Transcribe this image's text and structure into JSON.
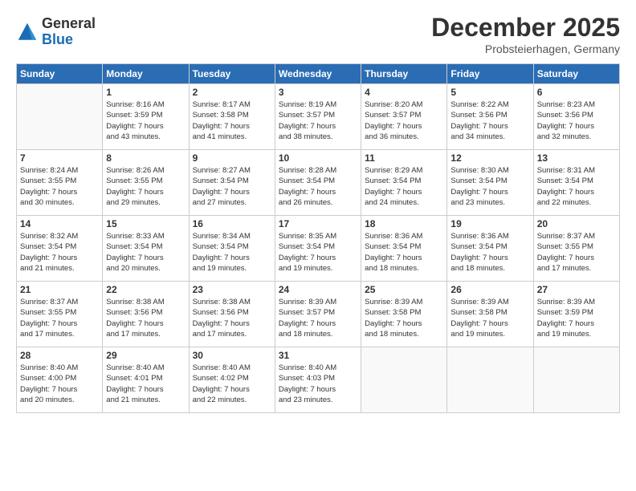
{
  "header": {
    "logo_general": "General",
    "logo_blue": "Blue",
    "month_title": "December 2025",
    "location": "Probsteierhagen, Germany"
  },
  "weekdays": [
    "Sunday",
    "Monday",
    "Tuesday",
    "Wednesday",
    "Thursday",
    "Friday",
    "Saturday"
  ],
  "weeks": [
    [
      {
        "day": "",
        "text": ""
      },
      {
        "day": "1",
        "text": "Sunrise: 8:16 AM\nSunset: 3:59 PM\nDaylight: 7 hours\nand 43 minutes."
      },
      {
        "day": "2",
        "text": "Sunrise: 8:17 AM\nSunset: 3:58 PM\nDaylight: 7 hours\nand 41 minutes."
      },
      {
        "day": "3",
        "text": "Sunrise: 8:19 AM\nSunset: 3:57 PM\nDaylight: 7 hours\nand 38 minutes."
      },
      {
        "day": "4",
        "text": "Sunrise: 8:20 AM\nSunset: 3:57 PM\nDaylight: 7 hours\nand 36 minutes."
      },
      {
        "day": "5",
        "text": "Sunrise: 8:22 AM\nSunset: 3:56 PM\nDaylight: 7 hours\nand 34 minutes."
      },
      {
        "day": "6",
        "text": "Sunrise: 8:23 AM\nSunset: 3:56 PM\nDaylight: 7 hours\nand 32 minutes."
      }
    ],
    [
      {
        "day": "7",
        "text": "Sunrise: 8:24 AM\nSunset: 3:55 PM\nDaylight: 7 hours\nand 30 minutes."
      },
      {
        "day": "8",
        "text": "Sunrise: 8:26 AM\nSunset: 3:55 PM\nDaylight: 7 hours\nand 29 minutes."
      },
      {
        "day": "9",
        "text": "Sunrise: 8:27 AM\nSunset: 3:54 PM\nDaylight: 7 hours\nand 27 minutes."
      },
      {
        "day": "10",
        "text": "Sunrise: 8:28 AM\nSunset: 3:54 PM\nDaylight: 7 hours\nand 26 minutes."
      },
      {
        "day": "11",
        "text": "Sunrise: 8:29 AM\nSunset: 3:54 PM\nDaylight: 7 hours\nand 24 minutes."
      },
      {
        "day": "12",
        "text": "Sunrise: 8:30 AM\nSunset: 3:54 PM\nDaylight: 7 hours\nand 23 minutes."
      },
      {
        "day": "13",
        "text": "Sunrise: 8:31 AM\nSunset: 3:54 PM\nDaylight: 7 hours\nand 22 minutes."
      }
    ],
    [
      {
        "day": "14",
        "text": "Sunrise: 8:32 AM\nSunset: 3:54 PM\nDaylight: 7 hours\nand 21 minutes."
      },
      {
        "day": "15",
        "text": "Sunrise: 8:33 AM\nSunset: 3:54 PM\nDaylight: 7 hours\nand 20 minutes."
      },
      {
        "day": "16",
        "text": "Sunrise: 8:34 AM\nSunset: 3:54 PM\nDaylight: 7 hours\nand 19 minutes."
      },
      {
        "day": "17",
        "text": "Sunrise: 8:35 AM\nSunset: 3:54 PM\nDaylight: 7 hours\nand 19 minutes."
      },
      {
        "day": "18",
        "text": "Sunrise: 8:36 AM\nSunset: 3:54 PM\nDaylight: 7 hours\nand 18 minutes."
      },
      {
        "day": "19",
        "text": "Sunrise: 8:36 AM\nSunset: 3:54 PM\nDaylight: 7 hours\nand 18 minutes."
      },
      {
        "day": "20",
        "text": "Sunrise: 8:37 AM\nSunset: 3:55 PM\nDaylight: 7 hours\nand 17 minutes."
      }
    ],
    [
      {
        "day": "21",
        "text": "Sunrise: 8:37 AM\nSunset: 3:55 PM\nDaylight: 7 hours\nand 17 minutes."
      },
      {
        "day": "22",
        "text": "Sunrise: 8:38 AM\nSunset: 3:56 PM\nDaylight: 7 hours\nand 17 minutes."
      },
      {
        "day": "23",
        "text": "Sunrise: 8:38 AM\nSunset: 3:56 PM\nDaylight: 7 hours\nand 17 minutes."
      },
      {
        "day": "24",
        "text": "Sunrise: 8:39 AM\nSunset: 3:57 PM\nDaylight: 7 hours\nand 18 minutes."
      },
      {
        "day": "25",
        "text": "Sunrise: 8:39 AM\nSunset: 3:58 PM\nDaylight: 7 hours\nand 18 minutes."
      },
      {
        "day": "26",
        "text": "Sunrise: 8:39 AM\nSunset: 3:58 PM\nDaylight: 7 hours\nand 19 minutes."
      },
      {
        "day": "27",
        "text": "Sunrise: 8:39 AM\nSunset: 3:59 PM\nDaylight: 7 hours\nand 19 minutes."
      }
    ],
    [
      {
        "day": "28",
        "text": "Sunrise: 8:40 AM\nSunset: 4:00 PM\nDaylight: 7 hours\nand 20 minutes."
      },
      {
        "day": "29",
        "text": "Sunrise: 8:40 AM\nSunset: 4:01 PM\nDaylight: 7 hours\nand 21 minutes."
      },
      {
        "day": "30",
        "text": "Sunrise: 8:40 AM\nSunset: 4:02 PM\nDaylight: 7 hours\nand 22 minutes."
      },
      {
        "day": "31",
        "text": "Sunrise: 8:40 AM\nSunset: 4:03 PM\nDaylight: 7 hours\nand 23 minutes."
      },
      {
        "day": "",
        "text": ""
      },
      {
        "day": "",
        "text": ""
      },
      {
        "day": "",
        "text": ""
      }
    ]
  ]
}
